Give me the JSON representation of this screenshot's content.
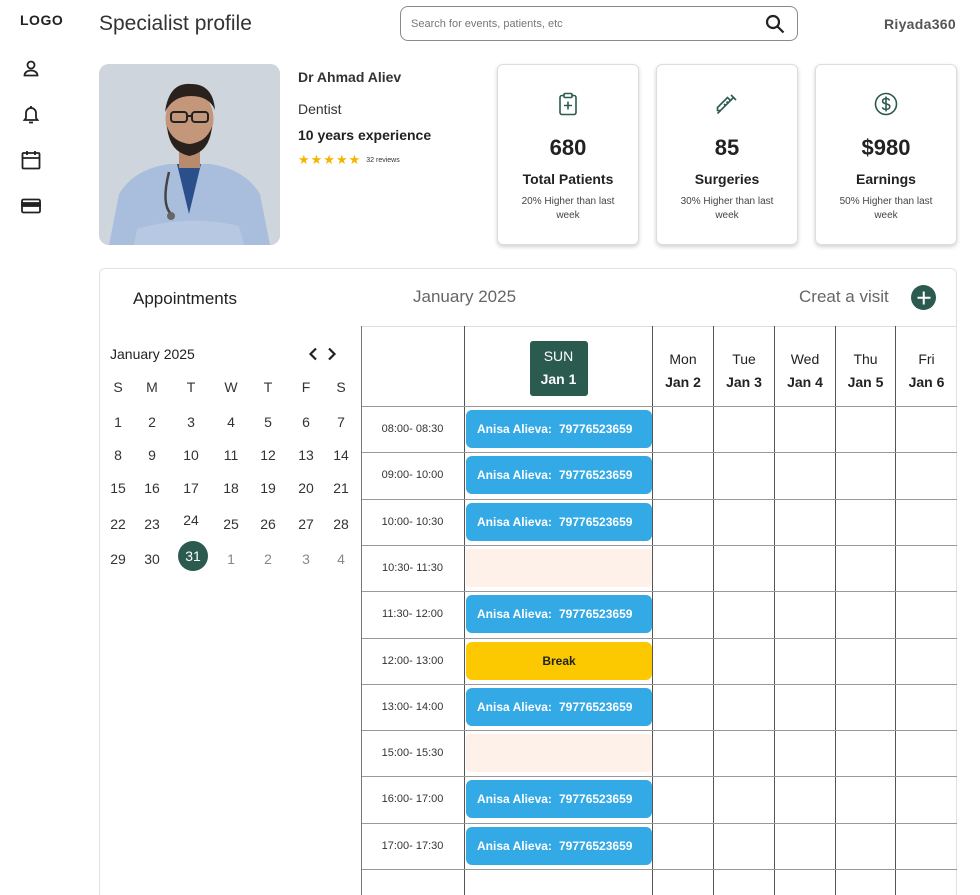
{
  "sidebar": {
    "logo": "LOGO",
    "icons": [
      "user-icon",
      "bell-icon",
      "calendar-icon",
      "credit-card-icon"
    ]
  },
  "header": {
    "title": "Specialist profile",
    "search_placeholder": "Search for events, patients, etc",
    "brand": "Riyada360"
  },
  "profile": {
    "name": "Dr Ahmad Aliev",
    "role": "Dentist",
    "experience": "10 years experience",
    "rating_stars": 5,
    "reviews": "32 reviews"
  },
  "stats": [
    {
      "icon": "clipboard-plus-icon",
      "value": "680",
      "label": "Total Patients",
      "note": "20% Higher than last week"
    },
    {
      "icon": "syringe-icon",
      "value": "85",
      "label": "Surgeries",
      "note": "30% Higher than last week"
    },
    {
      "icon": "dollar-icon",
      "value": "$980",
      "label": "Earnings",
      "note": "50% Higher than last week"
    }
  ],
  "appointments": {
    "title": "Appointments",
    "current_month": "January 2025",
    "create_label": "Creat a visit"
  },
  "mini_calendar": {
    "month": "January 2025",
    "weekdays": [
      "S",
      "M",
      "T",
      "W",
      "T",
      "F",
      "S"
    ],
    "weeks": [
      [
        "1",
        "2",
        "3",
        "4",
        "5",
        "6",
        "7"
      ],
      [
        "8",
        "9",
        "10",
        "11",
        "12",
        "13",
        "14"
      ],
      [
        "15",
        "16",
        "17",
        "18",
        "19",
        "20",
        "21"
      ],
      [
        "22",
        "23",
        "24",
        "25",
        "26",
        "27",
        "28"
      ],
      [
        "29",
        "30",
        "31",
        "1",
        "2",
        "3",
        "4"
      ]
    ],
    "selected": "31"
  },
  "schedule": {
    "days": [
      {
        "name": "SUN",
        "date": "Jan 1",
        "active": true
      },
      {
        "name": "Mon",
        "date": "Jan 2"
      },
      {
        "name": "Tue",
        "date": "Jan 3"
      },
      {
        "name": "Wed",
        "date": "Jan 4"
      },
      {
        "name": "Thu",
        "date": "Jan 5"
      },
      {
        "name": "Fri",
        "date": "Jan 6"
      }
    ],
    "slots": [
      {
        "time": "08:00- 08:30",
        "type": "appointment",
        "patient": "Anisa Alieva:",
        "phone": "79776523659"
      },
      {
        "time": "09:00- 10:00",
        "type": "appointment",
        "patient": "Anisa Alieva:",
        "phone": "79776523659"
      },
      {
        "time": "10:00- 10:30",
        "type": "appointment",
        "patient": "Anisa Alieva:",
        "phone": "79776523659"
      },
      {
        "time": "10:30- 11:30",
        "type": "empty"
      },
      {
        "time": "11:30- 12:00",
        "type": "appointment",
        "patient": "Anisa Alieva:",
        "phone": "79776523659"
      },
      {
        "time": "12:00- 13:00",
        "type": "break",
        "label": "Break"
      },
      {
        "time": "13:00- 14:00",
        "type": "appointment",
        "patient": "Anisa Alieva:",
        "phone": "79776523659"
      },
      {
        "time": "15:00- 15:30",
        "type": "empty"
      },
      {
        "time": "16:00- 17:00",
        "type": "appointment",
        "patient": "Anisa Alieva:",
        "phone": "79776523659"
      },
      {
        "time": "17:00- 17:30",
        "type": "appointment",
        "patient": "Anisa Alieva:",
        "phone": "79776523659"
      }
    ]
  },
  "colors": {
    "accent": "#2b5a4f",
    "appointment": "#33a9e6",
    "break": "#fcc900",
    "empty_slot": "#fdf1ea",
    "star": "#f4b400"
  }
}
